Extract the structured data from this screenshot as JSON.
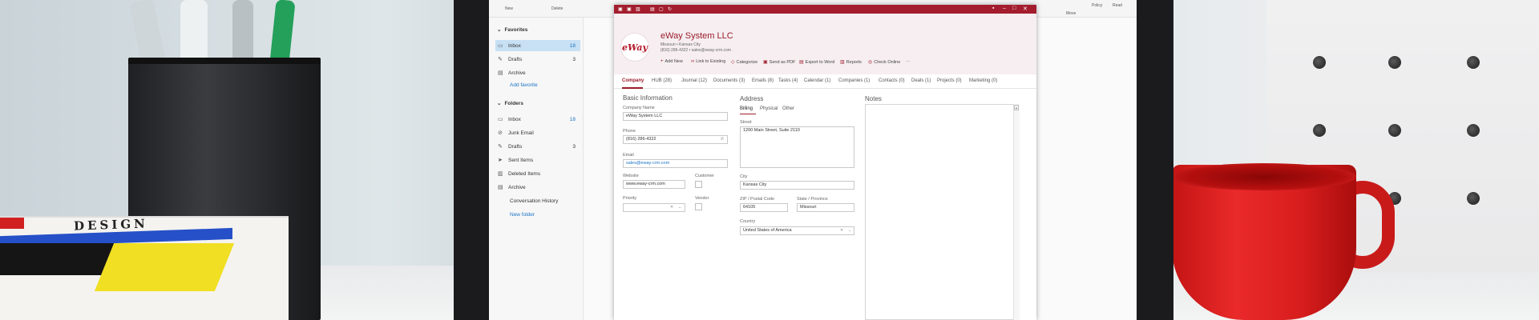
{
  "ribbon": {
    "left_items": [
      "New",
      "Delete"
    ],
    "right_items": [
      "Move",
      "Policy",
      "Read"
    ]
  },
  "nav": {
    "favorites_label": "Favorites",
    "favorites": [
      {
        "label": "Inbox",
        "count": "18",
        "icon": "inbox-icon"
      },
      {
        "label": "Drafts",
        "count": "3",
        "icon": "pencil-icon"
      },
      {
        "label": "Archive",
        "count": "",
        "icon": "archive-icon"
      }
    ],
    "add_favorite": "Add favorite",
    "folders_label": "Folders",
    "folders": [
      {
        "label": "Inbox",
        "count": "18",
        "icon": "inbox-icon"
      },
      {
        "label": "Junk Email",
        "count": "",
        "icon": "junk-icon"
      },
      {
        "label": "Drafts",
        "count": "3",
        "icon": "pencil-icon"
      },
      {
        "label": "Sent Items",
        "count": "",
        "icon": "send-icon"
      },
      {
        "label": "Deleted Items",
        "count": "",
        "icon": "trash-icon"
      },
      {
        "label": "Archive",
        "count": "",
        "icon": "archive-icon"
      }
    ],
    "conversation_history": "Conversation History",
    "new_folder": "New folder"
  },
  "dialog": {
    "logo_text": "eWay",
    "title": "eWay System LLC",
    "location": "Missouri • Kansas City",
    "contact_line": "(816) 286-4322 • sales@eway-crm.com",
    "actions": [
      {
        "label": "Add New",
        "icon": "plus-icon"
      },
      {
        "label": "Link to Existing",
        "icon": "link-icon"
      },
      {
        "label": "Categorize",
        "icon": "tag-icon"
      },
      {
        "label": "Send as PDF",
        "icon": "pdf-icon"
      },
      {
        "label": "Export to Word",
        "icon": "word-icon"
      },
      {
        "label": "Reports",
        "icon": "reports-icon"
      },
      {
        "label": "Check Online",
        "icon": "globe-icon"
      },
      {
        "label": "···",
        "icon": "more-icon"
      }
    ],
    "tabs": [
      "Company",
      "HUB (28)",
      "Journal (12)",
      "Documents (3)",
      "Emails (8)",
      "Tasks (4)",
      "Calendar (1)",
      "Companies (1)",
      "Contacts (0)",
      "Deals (1)",
      "Projects (0)",
      "Marketing (0)"
    ],
    "basic": {
      "title": "Basic Information",
      "company_name_label": "Company Name",
      "company_name": "eWay System LLC",
      "phone_label": "Phone",
      "phone": "(816) 286-4322",
      "email_label": "Email",
      "email": "sales@eway-crm.com",
      "website_label": "Website",
      "website": "www.eway-crm.com",
      "customer_label": "Customer",
      "priority_label": "Priority",
      "vendor_label": "Vendor"
    },
    "address": {
      "title": "Address",
      "tabs": [
        "Billing",
        "Physical",
        "Other"
      ],
      "street_label": "Street",
      "street": "1200 Main Street, Suite 2110",
      "city_label": "City",
      "city": "Kansas City",
      "zip_label": "ZIP / Postal Code",
      "zip": "64105",
      "state_label": "State / Province",
      "state": "Missouri",
      "country_label": "Country",
      "country": "United States of America"
    },
    "notes": {
      "title": "Notes"
    }
  },
  "background": {
    "book_title": "DESIGN",
    "accent_color": "#9b1c2c",
    "link_color": "#1a73c5"
  }
}
